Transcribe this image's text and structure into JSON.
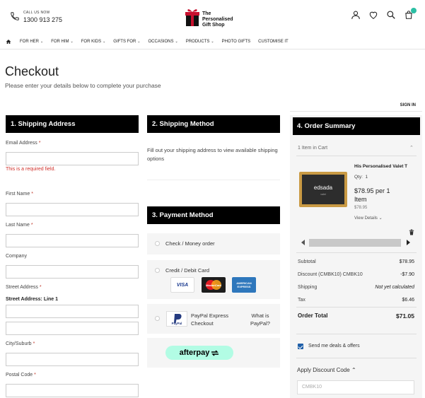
{
  "header": {
    "call_label": "CALL US NOW",
    "phone_number": "1300 913 275",
    "logo_line1": "The",
    "logo_line2": "Personalised",
    "logo_line3": "Gift Shop"
  },
  "nav": {
    "items": [
      "FOR HER",
      "FOR HIM",
      "FOR KIDS",
      "GIFTS FOR",
      "OCCASIONS",
      "PRODUCTS",
      "PHOTO GIFTS",
      "CUSTOMISE IT"
    ],
    "has_dropdown": [
      true,
      true,
      true,
      true,
      true,
      true,
      false,
      false
    ]
  },
  "page": {
    "title": "Checkout",
    "subtitle": "Please enter your details below to complete your purchase",
    "sign_in": "SIGN IN"
  },
  "shipping_address": {
    "heading": "1. Shipping Address",
    "email_label": "Email Address",
    "email_error": "This is a required field.",
    "first_name_label": "First Name",
    "last_name_label": "Last Name",
    "company_label": "Company",
    "street_label": "Street Address",
    "street_line1_label": "Street Address: Line 1",
    "city_label": "City/Suburb",
    "postal_label": "Postal Code",
    "required_marker": "*"
  },
  "shipping_method": {
    "heading": "2. Shipping Method",
    "message": "Fill out your shipping address to view available shipping options"
  },
  "payment": {
    "heading": "3. Payment Method",
    "check_label": "Check / Money order",
    "card_label": "Credit / Debit Card",
    "cards": [
      "VISA",
      "MasterCard",
      "AMERICAN EXPRESS"
    ],
    "paypal_logo": "PayPal",
    "paypal_line1": "PayPal Express",
    "paypal_line2": "Checkout",
    "paypal_what1": "What is",
    "paypal_what2": "PayPal?",
    "afterpay_label": "afterpay"
  },
  "order_summary": {
    "heading": "4. Order Summary",
    "items_count": "1 Item in Cart",
    "product_name": "His Personalised Valet T",
    "product_brand": "edsada",
    "product_brand_sub": "valet",
    "qty_label": "Qty:",
    "qty_value": "1",
    "price_line1": "$78.95 per 1",
    "price_line2": "Item",
    "price_small": "$78.95",
    "view_details": "View Details",
    "rows": [
      {
        "label": "Subtotal",
        "value": "$78.95"
      },
      {
        "label": "Discount (CMBK10) CMBK10",
        "value": "-$7.90"
      },
      {
        "label": "Shipping",
        "value": "Not yet calculated"
      },
      {
        "label": "Tax",
        "value": "$6.46"
      }
    ],
    "total_label": "Order Total",
    "total_value": "$71.05",
    "deals_label": "Send me deals & offers",
    "discount_heading": "Apply Discount Code",
    "discount_placeholder": "CMBK10"
  }
}
